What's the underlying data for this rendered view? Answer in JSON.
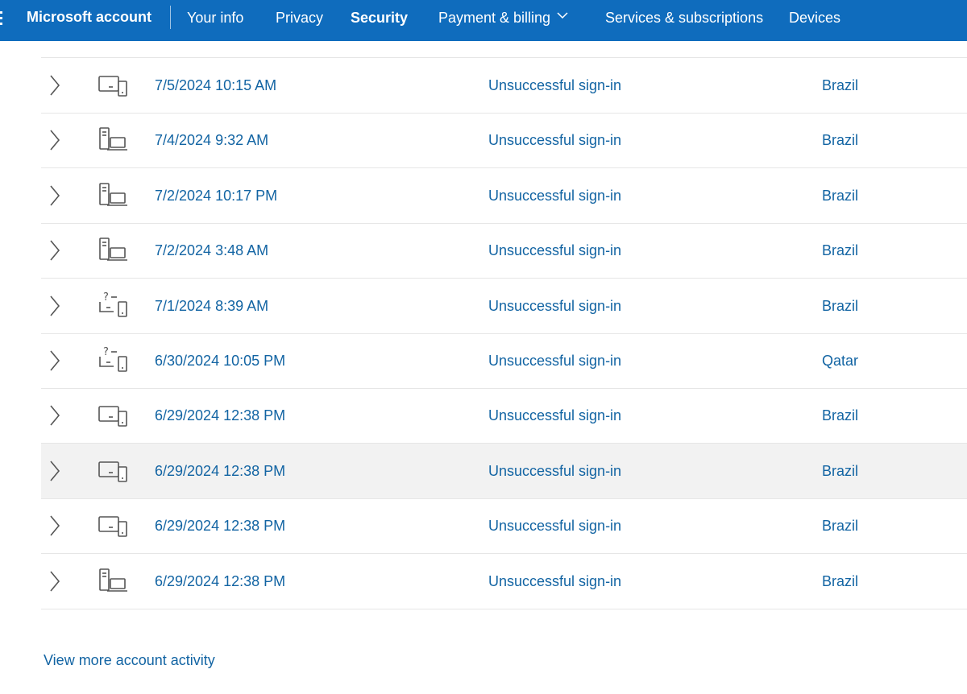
{
  "header": {
    "brand": "Microsoft account",
    "nav": [
      {
        "label": "Your info",
        "active": false
      },
      {
        "label": "Privacy",
        "active": false
      },
      {
        "label": "Security",
        "active": true
      },
      {
        "label": "Payment & billing",
        "active": false,
        "dropdown": true
      },
      {
        "label": "Services & subscriptions",
        "active": false
      },
      {
        "label": "Devices",
        "active": false
      }
    ]
  },
  "activity": {
    "rows": [
      {
        "date": "7/5/2024 10:15 AM",
        "status": "Unsuccessful sign-in",
        "location": "Brazil",
        "device": "laptop-phone-icon"
      },
      {
        "date": "7/4/2024 9:32 AM",
        "status": "Unsuccessful sign-in",
        "location": "Brazil",
        "device": "desktop-laptop-icon"
      },
      {
        "date": "7/2/2024 10:17 PM",
        "status": "Unsuccessful sign-in",
        "location": "Brazil",
        "device": "desktop-laptop-icon"
      },
      {
        "date": "7/2/2024 3:48 AM",
        "status": "Unsuccessful sign-in",
        "location": "Brazil",
        "device": "desktop-laptop-icon"
      },
      {
        "date": "7/1/2024 8:39 AM",
        "status": "Unsuccessful sign-in",
        "location": "Brazil",
        "device": "unknown-device-icon"
      },
      {
        "date": "6/30/2024 10:05 PM",
        "status": "Unsuccessful sign-in",
        "location": "Qatar",
        "device": "unknown-device-icon"
      },
      {
        "date": "6/29/2024 12:38 PM",
        "status": "Unsuccessful sign-in",
        "location": "Brazil",
        "device": "laptop-phone-icon"
      },
      {
        "date": "6/29/2024 12:38 PM",
        "status": "Unsuccessful sign-in",
        "location": "Brazil",
        "device": "laptop-phone-icon"
      },
      {
        "date": "6/29/2024 12:38 PM",
        "status": "Unsuccessful sign-in",
        "location": "Brazil",
        "device": "laptop-phone-icon"
      },
      {
        "date": "6/29/2024 12:38 PM",
        "status": "Unsuccessful sign-in",
        "location": "Brazil",
        "device": "desktop-laptop-icon"
      }
    ],
    "highlighted_row": 7
  },
  "footer": {
    "more_link": "View more account activity"
  },
  "colors": {
    "header_bg": "#0f6cbd",
    "link": "#1264a3",
    "row_highlight": "#f2f2f2",
    "divider": "#e6e6e6",
    "icon": "#555555"
  }
}
